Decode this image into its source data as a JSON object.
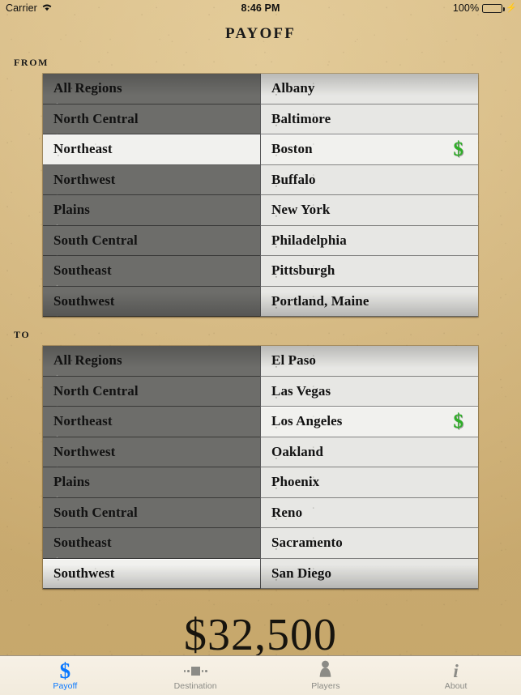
{
  "status_bar": {
    "carrier": "Carrier",
    "wifi_icon": "wifi-icon",
    "time": "8:46 PM",
    "battery_percent": "100%",
    "battery_icon": "battery-icon",
    "charging_icon": "lightning-bolt-icon"
  },
  "header": {
    "title": "Payoff"
  },
  "from": {
    "label": "From",
    "regions": [
      {
        "label": "All Regions",
        "selected": false
      },
      {
        "label": "North Central",
        "selected": false
      },
      {
        "label": "Northeast",
        "selected": true
      },
      {
        "label": "Northwest",
        "selected": false
      },
      {
        "label": "Plains",
        "selected": false
      },
      {
        "label": "South Central",
        "selected": false
      },
      {
        "label": "Southeast",
        "selected": false
      },
      {
        "label": "Southwest",
        "selected": false
      }
    ],
    "cities": [
      {
        "label": "Albany",
        "selected": false
      },
      {
        "label": "Baltimore",
        "selected": false
      },
      {
        "label": "Boston",
        "selected": true
      },
      {
        "label": "Buffalo",
        "selected": false
      },
      {
        "label": "New York",
        "selected": false
      },
      {
        "label": "Philadelphia",
        "selected": false
      },
      {
        "label": "Pittsburgh",
        "selected": false
      },
      {
        "label": "Portland, Maine",
        "selected": false
      }
    ]
  },
  "to": {
    "label": "To",
    "regions": [
      {
        "label": "All Regions",
        "selected": false
      },
      {
        "label": "North Central",
        "selected": false
      },
      {
        "label": "Northeast",
        "selected": false
      },
      {
        "label": "Northwest",
        "selected": false
      },
      {
        "label": "Plains",
        "selected": false
      },
      {
        "label": "South Central",
        "selected": false
      },
      {
        "label": "Southeast",
        "selected": false
      },
      {
        "label": "Southwest",
        "selected": true
      }
    ],
    "cities": [
      {
        "label": "El Paso",
        "selected": false
      },
      {
        "label": "Las Vegas",
        "selected": false
      },
      {
        "label": "Los Angeles",
        "selected": true
      },
      {
        "label": "Oakland",
        "selected": false
      },
      {
        "label": "Phoenix",
        "selected": false
      },
      {
        "label": "Reno",
        "selected": false
      },
      {
        "label": "Sacramento",
        "selected": false
      },
      {
        "label": "San Diego",
        "selected": false
      }
    ]
  },
  "payoff": {
    "amount": "$32,500"
  },
  "selection_marker": "$",
  "tab_bar": {
    "items": [
      {
        "label": "Payoff",
        "icon": "dollar-icon",
        "active": true
      },
      {
        "label": "Destination",
        "icon": "destination-icon",
        "active": false
      },
      {
        "label": "Players",
        "icon": "pawn-icon",
        "active": false
      },
      {
        "label": "About",
        "icon": "info-icon",
        "active": false
      }
    ]
  },
  "colors": {
    "accent": "#0a78ff",
    "money_green": "#2faf28",
    "paper": "#ecdcba",
    "region_panel": "#6d6d6a",
    "city_panel": "#e7e7e4",
    "selected_row": "#f1f1ee"
  }
}
